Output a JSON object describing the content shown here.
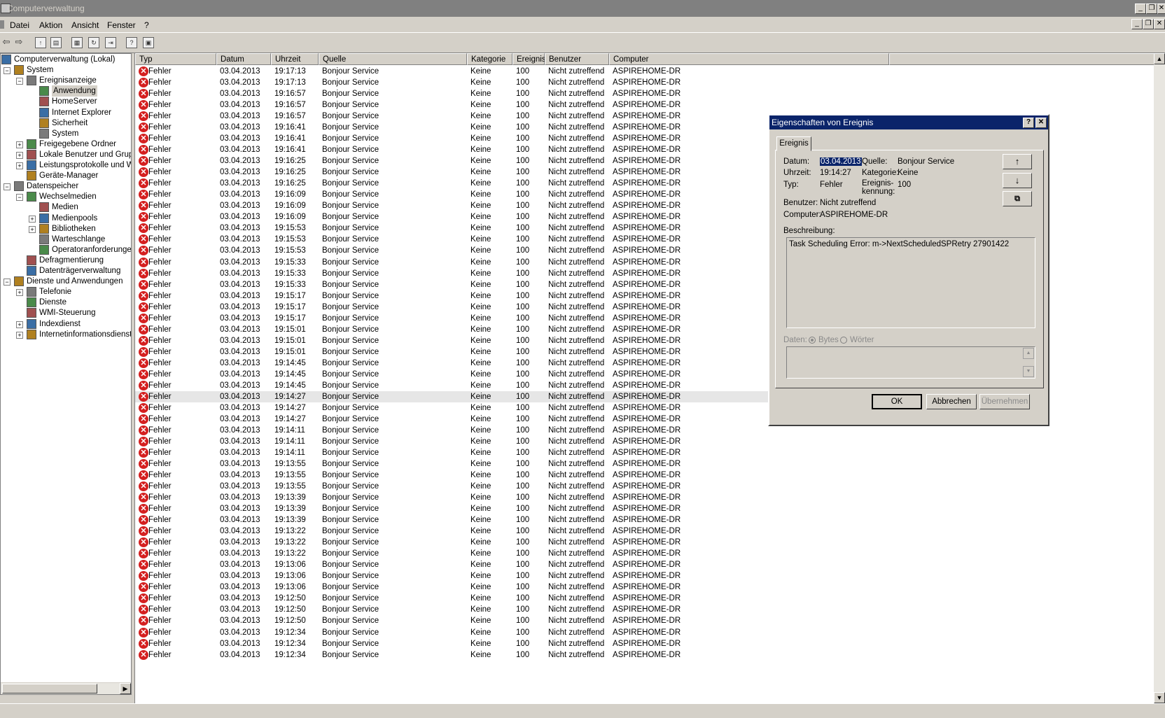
{
  "window": {
    "title": "Computerverwaltung"
  },
  "menu": [
    "Datei",
    "Aktion",
    "Ansicht",
    "Fenster",
    "?"
  ],
  "tree": [
    {
      "label": "Computerverwaltung (Lokal)",
      "level": 0,
      "exp": "",
      "icon": "computer-icon"
    },
    {
      "label": "System",
      "level": 1,
      "exp": "−",
      "icon": "tools-icon"
    },
    {
      "label": "Ereignisanzeige",
      "level": 2,
      "exp": "−",
      "icon": "event-viewer-icon"
    },
    {
      "label": "Anwendung",
      "level": 3,
      "exp": "",
      "icon": "log-icon",
      "selected": true
    },
    {
      "label": "HomeServer",
      "level": 3,
      "exp": "",
      "icon": "log-icon"
    },
    {
      "label": "Internet Explorer",
      "level": 3,
      "exp": "",
      "icon": "log-icon"
    },
    {
      "label": "Sicherheit",
      "level": 3,
      "exp": "",
      "icon": "log-icon"
    },
    {
      "label": "System",
      "level": 3,
      "exp": "",
      "icon": "log-icon"
    },
    {
      "label": "Freigegebene Ordner",
      "level": 2,
      "exp": "+",
      "icon": "folder-icon"
    },
    {
      "label": "Lokale Benutzer und Gruppe",
      "level": 2,
      "exp": "+",
      "icon": "users-icon"
    },
    {
      "label": "Leistungsprotokolle und War",
      "level": 2,
      "exp": "+",
      "icon": "performance-icon"
    },
    {
      "label": "Geräte-Manager",
      "level": 2,
      "exp": "",
      "icon": "device-manager-icon"
    },
    {
      "label": "Datenspeicher",
      "level": 1,
      "exp": "−",
      "icon": "storage-icon"
    },
    {
      "label": "Wechselmedien",
      "level": 2,
      "exp": "−",
      "icon": "removable-media-icon"
    },
    {
      "label": "Medien",
      "level": 3,
      "exp": "",
      "icon": "media-icon"
    },
    {
      "label": "Medienpools",
      "level": 3,
      "exp": "+",
      "icon": "media-pool-icon"
    },
    {
      "label": "Bibliotheken",
      "level": 3,
      "exp": "+",
      "icon": "library-icon"
    },
    {
      "label": "Warteschlange",
      "level": 3,
      "exp": "",
      "icon": "queue-icon"
    },
    {
      "label": "Operatoranforderungen",
      "level": 3,
      "exp": "",
      "icon": "operator-icon"
    },
    {
      "label": "Defragmentierung",
      "level": 2,
      "exp": "",
      "icon": "defrag-icon"
    },
    {
      "label": "Datenträgerverwaltung",
      "level": 2,
      "exp": "",
      "icon": "disk-management-icon"
    },
    {
      "label": "Dienste und Anwendungen",
      "level": 1,
      "exp": "−",
      "icon": "services-apps-icon"
    },
    {
      "label": "Telefonie",
      "level": 2,
      "exp": "+",
      "icon": "telephony-icon"
    },
    {
      "label": "Dienste",
      "level": 2,
      "exp": "",
      "icon": "services-icon"
    },
    {
      "label": "WMI-Steuerung",
      "level": 2,
      "exp": "",
      "icon": "wmi-icon"
    },
    {
      "label": "Indexdienst",
      "level": 2,
      "exp": "+",
      "icon": "index-icon"
    },
    {
      "label": "Internetinformationsdienste",
      "level": 2,
      "exp": "+",
      "icon": "iis-icon"
    }
  ],
  "columns": [
    "Typ",
    "Datum",
    "Uhrzeit",
    "Quelle",
    "Kategorie",
    "Ereignis",
    "Benutzer",
    "Computer"
  ],
  "events": [
    [
      "Fehler",
      "03.04.2013",
      "19:17:13",
      "Bonjour Service",
      "Keine",
      "100",
      "Nicht zutreffend",
      "ASPIREHOME-DR"
    ],
    [
      "Fehler",
      "03.04.2013",
      "19:17:13",
      "Bonjour Service",
      "Keine",
      "100",
      "Nicht zutreffend",
      "ASPIREHOME-DR"
    ],
    [
      "Fehler",
      "03.04.2013",
      "19:16:57",
      "Bonjour Service",
      "Keine",
      "100",
      "Nicht zutreffend",
      "ASPIREHOME-DR"
    ],
    [
      "Fehler",
      "03.04.2013",
      "19:16:57",
      "Bonjour Service",
      "Keine",
      "100",
      "Nicht zutreffend",
      "ASPIREHOME-DR"
    ],
    [
      "Fehler",
      "03.04.2013",
      "19:16:57",
      "Bonjour Service",
      "Keine",
      "100",
      "Nicht zutreffend",
      "ASPIREHOME-DR"
    ],
    [
      "Fehler",
      "03.04.2013",
      "19:16:41",
      "Bonjour Service",
      "Keine",
      "100",
      "Nicht zutreffend",
      "ASPIREHOME-DR"
    ],
    [
      "Fehler",
      "03.04.2013",
      "19:16:41",
      "Bonjour Service",
      "Keine",
      "100",
      "Nicht zutreffend",
      "ASPIREHOME-DR"
    ],
    [
      "Fehler",
      "03.04.2013",
      "19:16:41",
      "Bonjour Service",
      "Keine",
      "100",
      "Nicht zutreffend",
      "ASPIREHOME-DR"
    ],
    [
      "Fehler",
      "03.04.2013",
      "19:16:25",
      "Bonjour Service",
      "Keine",
      "100",
      "Nicht zutreffend",
      "ASPIREHOME-DR"
    ],
    [
      "Fehler",
      "03.04.2013",
      "19:16:25",
      "Bonjour Service",
      "Keine",
      "100",
      "Nicht zutreffend",
      "ASPIREHOME-DR"
    ],
    [
      "Fehler",
      "03.04.2013",
      "19:16:25",
      "Bonjour Service",
      "Keine",
      "100",
      "Nicht zutreffend",
      "ASPIREHOME-DR"
    ],
    [
      "Fehler",
      "03.04.2013",
      "19:16:09",
      "Bonjour Service",
      "Keine",
      "100",
      "Nicht zutreffend",
      "ASPIREHOME-DR"
    ],
    [
      "Fehler",
      "03.04.2013",
      "19:16:09",
      "Bonjour Service",
      "Keine",
      "100",
      "Nicht zutreffend",
      "ASPIREHOME-DR"
    ],
    [
      "Fehler",
      "03.04.2013",
      "19:16:09",
      "Bonjour Service",
      "Keine",
      "100",
      "Nicht zutreffend",
      "ASPIREHOME-DR"
    ],
    [
      "Fehler",
      "03.04.2013",
      "19:15:53",
      "Bonjour Service",
      "Keine",
      "100",
      "Nicht zutreffend",
      "ASPIREHOME-DR"
    ],
    [
      "Fehler",
      "03.04.2013",
      "19:15:53",
      "Bonjour Service",
      "Keine",
      "100",
      "Nicht zutreffend",
      "ASPIREHOME-DR"
    ],
    [
      "Fehler",
      "03.04.2013",
      "19:15:53",
      "Bonjour Service",
      "Keine",
      "100",
      "Nicht zutreffend",
      "ASPIREHOME-DR"
    ],
    [
      "Fehler",
      "03.04.2013",
      "19:15:33",
      "Bonjour Service",
      "Keine",
      "100",
      "Nicht zutreffend",
      "ASPIREHOME-DR"
    ],
    [
      "Fehler",
      "03.04.2013",
      "19:15:33",
      "Bonjour Service",
      "Keine",
      "100",
      "Nicht zutreffend",
      "ASPIREHOME-DR"
    ],
    [
      "Fehler",
      "03.04.2013",
      "19:15:33",
      "Bonjour Service",
      "Keine",
      "100",
      "Nicht zutreffend",
      "ASPIREHOME-DR"
    ],
    [
      "Fehler",
      "03.04.2013",
      "19:15:17",
      "Bonjour Service",
      "Keine",
      "100",
      "Nicht zutreffend",
      "ASPIREHOME-DR"
    ],
    [
      "Fehler",
      "03.04.2013",
      "19:15:17",
      "Bonjour Service",
      "Keine",
      "100",
      "Nicht zutreffend",
      "ASPIREHOME-DR"
    ],
    [
      "Fehler",
      "03.04.2013",
      "19:15:17",
      "Bonjour Service",
      "Keine",
      "100",
      "Nicht zutreffend",
      "ASPIREHOME-DR"
    ],
    [
      "Fehler",
      "03.04.2013",
      "19:15:01",
      "Bonjour Service",
      "Keine",
      "100",
      "Nicht zutreffend",
      "ASPIREHOME-DR"
    ],
    [
      "Fehler",
      "03.04.2013",
      "19:15:01",
      "Bonjour Service",
      "Keine",
      "100",
      "Nicht zutreffend",
      "ASPIREHOME-DR"
    ],
    [
      "Fehler",
      "03.04.2013",
      "19:15:01",
      "Bonjour Service",
      "Keine",
      "100",
      "Nicht zutreffend",
      "ASPIREHOME-DR"
    ],
    [
      "Fehler",
      "03.04.2013",
      "19:14:45",
      "Bonjour Service",
      "Keine",
      "100",
      "Nicht zutreffend",
      "ASPIREHOME-DR"
    ],
    [
      "Fehler",
      "03.04.2013",
      "19:14:45",
      "Bonjour Service",
      "Keine",
      "100",
      "Nicht zutreffend",
      "ASPIREHOME-DR"
    ],
    [
      "Fehler",
      "03.04.2013",
      "19:14:45",
      "Bonjour Service",
      "Keine",
      "100",
      "Nicht zutreffend",
      "ASPIREHOME-DR"
    ],
    [
      "Fehler",
      "03.04.2013",
      "19:14:27",
      "Bonjour Service",
      "Keine",
      "100",
      "Nicht zutreffend",
      "ASPIREHOME-DR"
    ],
    [
      "Fehler",
      "03.04.2013",
      "19:14:27",
      "Bonjour Service",
      "Keine",
      "100",
      "Nicht zutreffend",
      "ASPIREHOME-DR"
    ],
    [
      "Fehler",
      "03.04.2013",
      "19:14:27",
      "Bonjour Service",
      "Keine",
      "100",
      "Nicht zutreffend",
      "ASPIREHOME-DR"
    ],
    [
      "Fehler",
      "03.04.2013",
      "19:14:11",
      "Bonjour Service",
      "Keine",
      "100",
      "Nicht zutreffend",
      "ASPIREHOME-DR"
    ],
    [
      "Fehler",
      "03.04.2013",
      "19:14:11",
      "Bonjour Service",
      "Keine",
      "100",
      "Nicht zutreffend",
      "ASPIREHOME-DR"
    ],
    [
      "Fehler",
      "03.04.2013",
      "19:14:11",
      "Bonjour Service",
      "Keine",
      "100",
      "Nicht zutreffend",
      "ASPIREHOME-DR"
    ],
    [
      "Fehler",
      "03.04.2013",
      "19:13:55",
      "Bonjour Service",
      "Keine",
      "100",
      "Nicht zutreffend",
      "ASPIREHOME-DR"
    ],
    [
      "Fehler",
      "03.04.2013",
      "19:13:55",
      "Bonjour Service",
      "Keine",
      "100",
      "Nicht zutreffend",
      "ASPIREHOME-DR"
    ],
    [
      "Fehler",
      "03.04.2013",
      "19:13:55",
      "Bonjour Service",
      "Keine",
      "100",
      "Nicht zutreffend",
      "ASPIREHOME-DR"
    ],
    [
      "Fehler",
      "03.04.2013",
      "19:13:39",
      "Bonjour Service",
      "Keine",
      "100",
      "Nicht zutreffend",
      "ASPIREHOME-DR"
    ],
    [
      "Fehler",
      "03.04.2013",
      "19:13:39",
      "Bonjour Service",
      "Keine",
      "100",
      "Nicht zutreffend",
      "ASPIREHOME-DR"
    ],
    [
      "Fehler",
      "03.04.2013",
      "19:13:39",
      "Bonjour Service",
      "Keine",
      "100",
      "Nicht zutreffend",
      "ASPIREHOME-DR"
    ],
    [
      "Fehler",
      "03.04.2013",
      "19:13:22",
      "Bonjour Service",
      "Keine",
      "100",
      "Nicht zutreffend",
      "ASPIREHOME-DR"
    ],
    [
      "Fehler",
      "03.04.2013",
      "19:13:22",
      "Bonjour Service",
      "Keine",
      "100",
      "Nicht zutreffend",
      "ASPIREHOME-DR"
    ],
    [
      "Fehler",
      "03.04.2013",
      "19:13:22",
      "Bonjour Service",
      "Keine",
      "100",
      "Nicht zutreffend",
      "ASPIREHOME-DR"
    ],
    [
      "Fehler",
      "03.04.2013",
      "19:13:06",
      "Bonjour Service",
      "Keine",
      "100",
      "Nicht zutreffend",
      "ASPIREHOME-DR"
    ],
    [
      "Fehler",
      "03.04.2013",
      "19:13:06",
      "Bonjour Service",
      "Keine",
      "100",
      "Nicht zutreffend",
      "ASPIREHOME-DR"
    ],
    [
      "Fehler",
      "03.04.2013",
      "19:13:06",
      "Bonjour Service",
      "Keine",
      "100",
      "Nicht zutreffend",
      "ASPIREHOME-DR"
    ],
    [
      "Fehler",
      "03.04.2013",
      "19:12:50",
      "Bonjour Service",
      "Keine",
      "100",
      "Nicht zutreffend",
      "ASPIREHOME-DR"
    ],
    [
      "Fehler",
      "03.04.2013",
      "19:12:50",
      "Bonjour Service",
      "Keine",
      "100",
      "Nicht zutreffend",
      "ASPIREHOME-DR"
    ],
    [
      "Fehler",
      "03.04.2013",
      "19:12:50",
      "Bonjour Service",
      "Keine",
      "100",
      "Nicht zutreffend",
      "ASPIREHOME-DR"
    ],
    [
      "Fehler",
      "03.04.2013",
      "19:12:34",
      "Bonjour Service",
      "Keine",
      "100",
      "Nicht zutreffend",
      "ASPIREHOME-DR"
    ],
    [
      "Fehler",
      "03.04.2013",
      "19:12:34",
      "Bonjour Service",
      "Keine",
      "100",
      "Nicht zutreffend",
      "ASPIREHOME-DR"
    ],
    [
      "Fehler",
      "03.04.2013",
      "19:12:34",
      "Bonjour Service",
      "Keine",
      "100",
      "Nicht zutreffend",
      "ASPIREHOME-DR"
    ]
  ],
  "selected_event_time": "19:14:27",
  "dialog": {
    "title": "Eigenschaften von Ereignis",
    "help_btn": "?",
    "close_btn": "✕",
    "tab": "Ereignis",
    "datum_label": "Datum:",
    "datum": "03.04.2013",
    "quelle_label": "Quelle:",
    "quelle": "Bonjour Service",
    "uhrzeit_label": "Uhrzeit:",
    "uhrzeit": "19:14:27",
    "kategorie_label": "Kategorie:",
    "kategorie": "Keine",
    "typ_label": "Typ:",
    "typ": "Fehler",
    "kennung_label_1": "Ereignis-",
    "kennung_label_2": "kennung:",
    "kennung": "100",
    "benutzer_label": "Benutzer:",
    "benutzer": "Nicht zutreffend",
    "computer_label": "Computer:",
    "computer": "ASPIREHOME-DR",
    "beschreibung_label": "Beschreibung:",
    "beschreibung": "Task Scheduling Error: m->NextScheduledSPRetry 27901422",
    "daten_label": "Daten:",
    "bytes_label": "Bytes",
    "woerter_label": "Wörter",
    "ok": "OK",
    "abbrechen": "Abbrechen",
    "uebernehmen": "Übernehmen"
  }
}
